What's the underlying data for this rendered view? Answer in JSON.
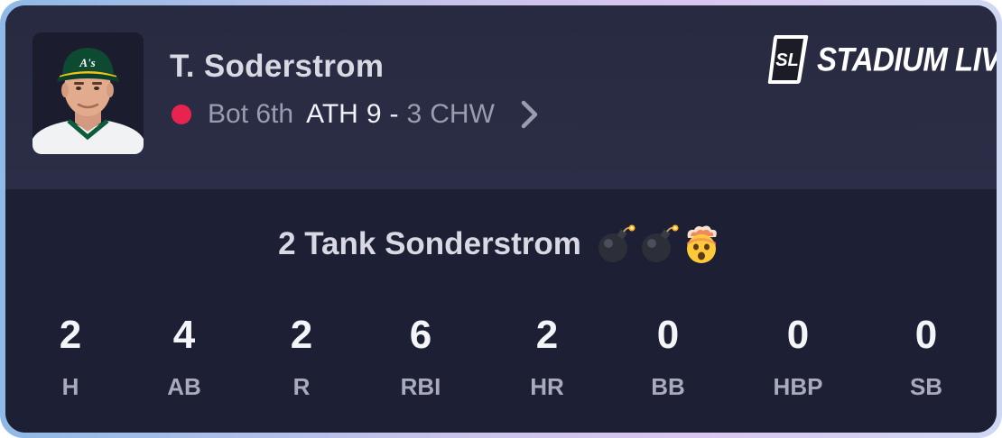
{
  "header": {
    "player_name": "T. Soderstrom",
    "inning": "Bot 6th",
    "home_team": "ATH",
    "home_score": "9",
    "dash": "-",
    "away_score": "3",
    "away_team": "CHW",
    "live_color": "#e8234f"
  },
  "brand": {
    "logo_mark": "SL",
    "logo_text": "STADIUM LIVE"
  },
  "headline": {
    "text": "2 Tank Sonderstrom",
    "emojis": [
      "bomb-icon",
      "bomb-icon",
      "exploding-head-icon"
    ]
  },
  "stats": [
    {
      "value": "2",
      "label": "H"
    },
    {
      "value": "4",
      "label": "AB"
    },
    {
      "value": "2",
      "label": "R"
    },
    {
      "value": "6",
      "label": "RBI"
    },
    {
      "value": "2",
      "label": "HR"
    },
    {
      "value": "0",
      "label": "BB"
    },
    {
      "value": "0",
      "label": "HBP"
    },
    {
      "value": "0",
      "label": "SB"
    }
  ]
}
